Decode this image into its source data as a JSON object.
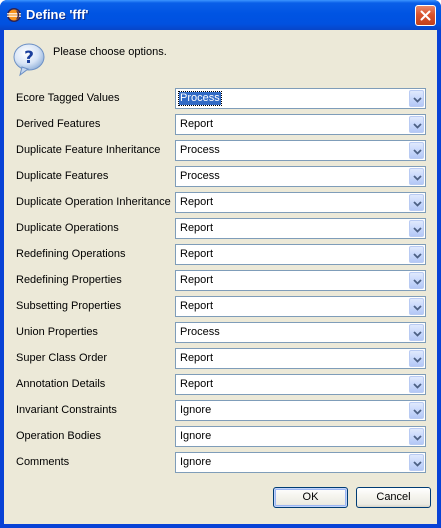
{
  "window": {
    "title": "Define 'fff'"
  },
  "icons": {
    "app": "eclipse-icon",
    "close": "close-icon",
    "info": "question-icon",
    "dropdown": "chevron-down-icon"
  },
  "message": "Please choose options.",
  "options": [
    {
      "label": "Ecore Tagged Values",
      "value": "Process",
      "focused": true
    },
    {
      "label": "Derived Features",
      "value": "Report"
    },
    {
      "label": "Duplicate Feature Inheritance",
      "value": "Process"
    },
    {
      "label": "Duplicate Features",
      "value": "Process"
    },
    {
      "label": "Duplicate Operation Inheritance",
      "value": "Report"
    },
    {
      "label": "Duplicate Operations",
      "value": "Report"
    },
    {
      "label": "Redefining Operations",
      "value": "Report"
    },
    {
      "label": "Redefining Properties",
      "value": "Report"
    },
    {
      "label": "Subsetting Properties",
      "value": "Report"
    },
    {
      "label": "Union Properties",
      "value": "Process"
    },
    {
      "label": "Super Class Order",
      "value": "Report"
    },
    {
      "label": "Annotation Details",
      "value": "Report"
    },
    {
      "label": "Invariant Constraints",
      "value": "Ignore"
    },
    {
      "label": "Operation Bodies",
      "value": "Ignore"
    },
    {
      "label": "Comments",
      "value": "Ignore"
    }
  ],
  "buttons": {
    "ok": "OK",
    "cancel": "Cancel"
  }
}
